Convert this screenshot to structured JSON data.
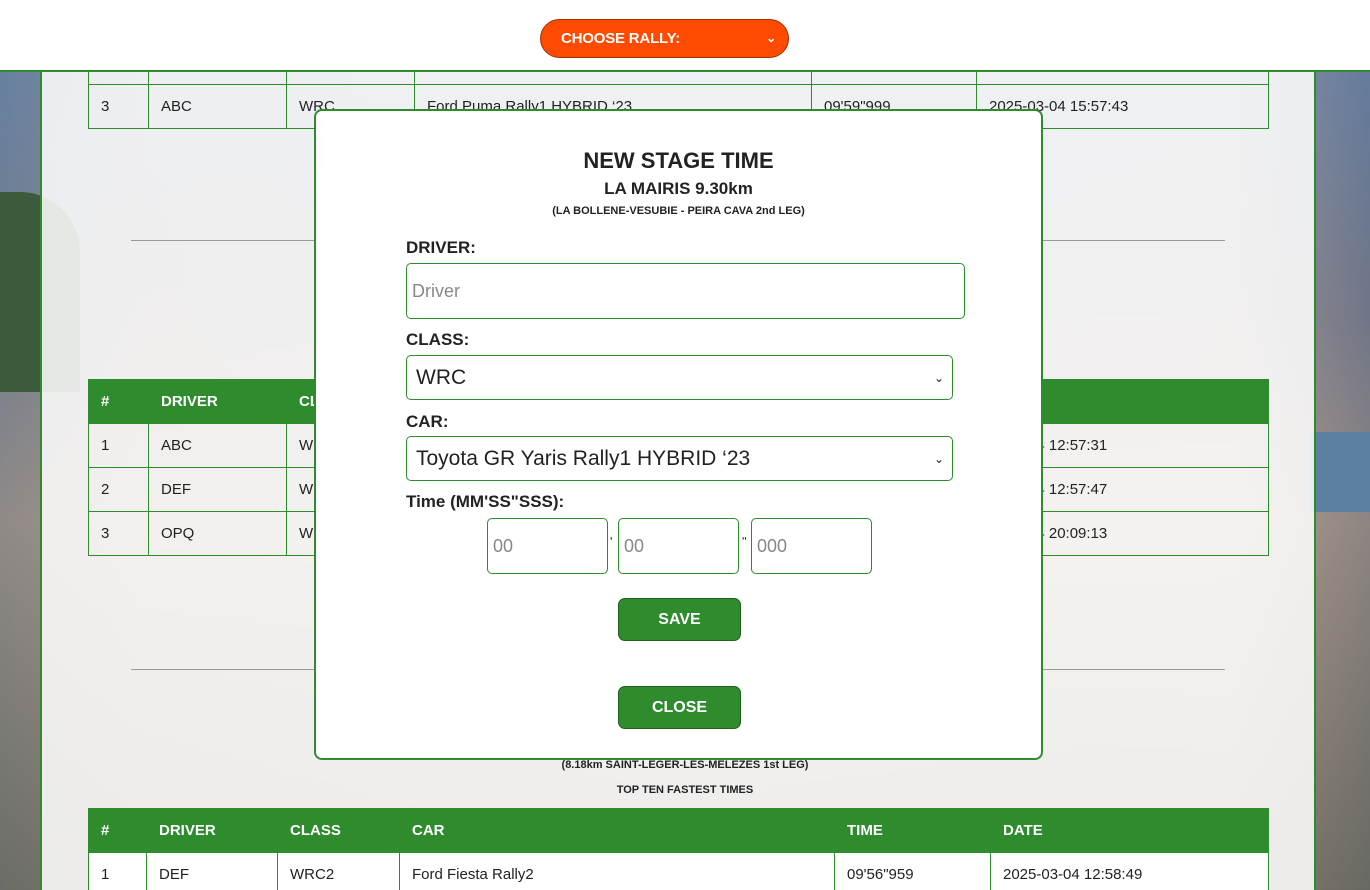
{
  "header": {
    "rally_select": "CHOOSE RALLY:"
  },
  "table_top": {
    "row": {
      "pos": "3",
      "driver": "ABC",
      "class": "WRC",
      "car": "Ford Puma Rally1 HYBRID ‘23",
      "time": "09'59\"999",
      "date": "2025-03-04 15:57:43"
    }
  },
  "table_mid": {
    "headers": [
      "#",
      "DRIVER",
      "CL",
      "",
      "",
      ""
    ],
    "rows": [
      {
        "pos": "1",
        "driver": "ABC",
        "class": "W",
        "date": "-04 12:57:31"
      },
      {
        "pos": "2",
        "driver": "DEF",
        "class": "W",
        "date": "-04 12:57:47"
      },
      {
        "pos": "3",
        "driver": "OPQ",
        "class": "W",
        "date": "-04 20:09:13"
      }
    ]
  },
  "section_bottom": {
    "subtitle": "(8.18km SAINT-LEGER-LES-MELEZES 1st LEG)",
    "top_ten": "TOP TEN FASTEST TIMES",
    "headers": [
      "#",
      "DRIVER",
      "CLASS",
      "CAR",
      "TIME",
      "DATE"
    ],
    "rows": [
      {
        "pos": "1",
        "driver": "DEF",
        "class": "WRC2",
        "car": "Ford Fiesta Rally2",
        "time": "09'56\"959",
        "date": "2025-03-04 12:58:49"
      }
    ]
  },
  "modal": {
    "title": "NEW STAGE TIME",
    "stage": "LA MAIRIS 9.30km",
    "stage_detail": "(LA BOLLENE-VESUBIE - PEIRA CAVA 2nd LEG)",
    "driver_label": "DRIVER:",
    "driver_placeholder": "Driver",
    "class_label": "CLASS:",
    "class_value": "WRC",
    "car_label": "CAR:",
    "car_value": "Toyota GR Yaris Rally1 HYBRID ‘23",
    "time_label": "Time (MM'SS\"SSS):",
    "minutes_placeholder": "00",
    "seconds_placeholder": "00",
    "millis_placeholder": "000",
    "sep_minutes": "'",
    "sep_seconds": "\"",
    "save_label": "SAVE",
    "close_label": "CLOSE"
  },
  "colors": {
    "accent": "#2e8b2e",
    "rally_button": "#ff4a00"
  }
}
